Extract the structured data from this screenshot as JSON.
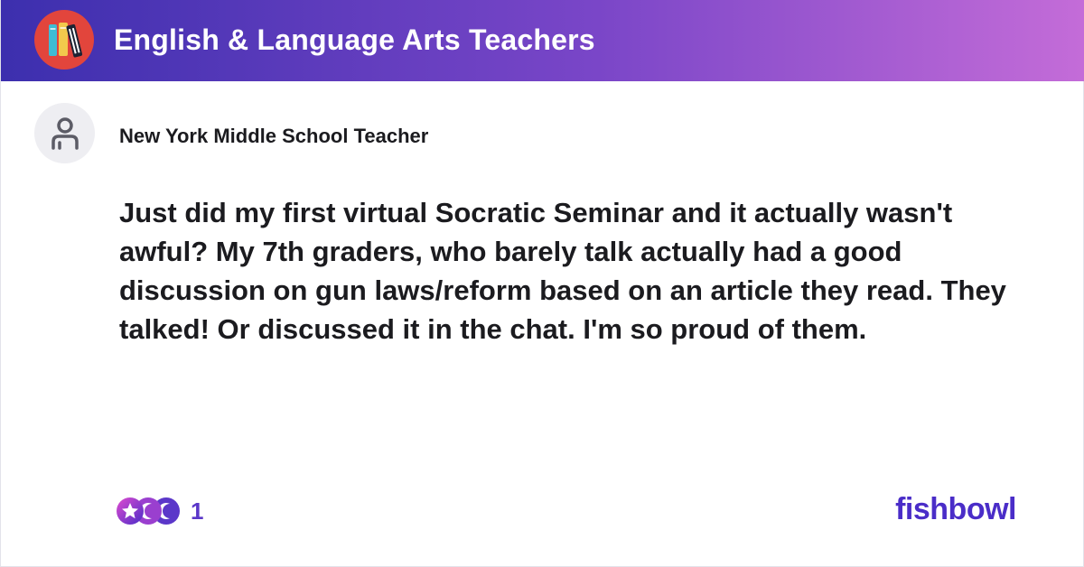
{
  "header": {
    "bowl_name": "English & Language Arts Teachers",
    "logo_icon": "books-icon",
    "gradient_colors": [
      "#3c2fae",
      "#7a46c8",
      "#c46cd8"
    ]
  },
  "post": {
    "author": "New York Middle School Teacher",
    "avatar_icon": "user-icon",
    "text": "Just did my first virtual Socratic Seminar and it actually wasn't awful? My 7th graders, who barely talk actually had a good discussion on gun laws/reform based on an article they read. They talked! Or discussed it in the chat. I'm so proud of them."
  },
  "reactions": {
    "count": "1",
    "icons": [
      "star-reaction-icon",
      "moon-reaction-icon",
      "moon-reaction-icon"
    ]
  },
  "brand": {
    "name": "fishbowl",
    "color": "#4a2dc8"
  }
}
